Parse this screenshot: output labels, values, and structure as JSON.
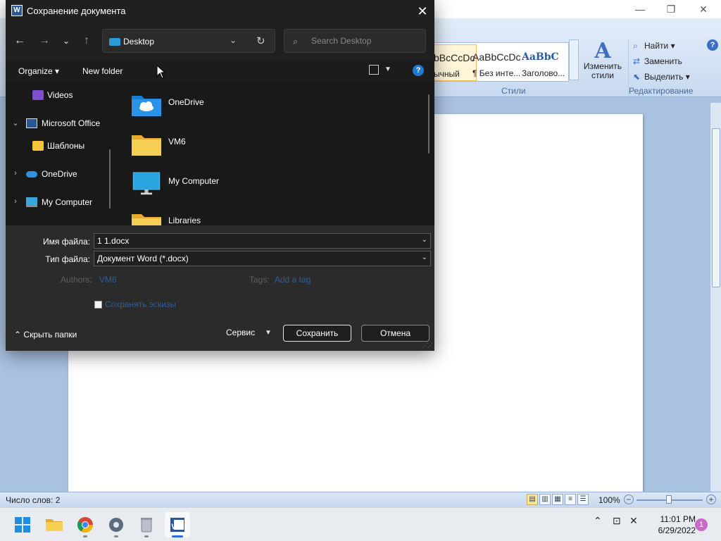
{
  "word": {
    "styles": [
      {
        "sample": "bBcCcDc",
        "name": "ычный",
        "active": true
      },
      {
        "sample": "AaBbCcDc",
        "name": "¶ Без инте...",
        "active": false
      },
      {
        "sample": "AaBbC",
        "name": "Заголово...",
        "active": false
      }
    ],
    "change_styles_label_1": "Изменить",
    "change_styles_label_2": "стили",
    "styles_group_label": "Стили",
    "editing": {
      "find": "Найти",
      "replace": "Заменить",
      "select": "Выделить",
      "group_label": "Редактирование"
    },
    "status": {
      "word_count": "Число слов: 2",
      "zoom": "100%"
    }
  },
  "dialog": {
    "title": "Сохранение документа",
    "address": "Desktop",
    "search_placeholder": "Search Desktop",
    "organize": "Organize",
    "new_folder": "New folder",
    "nav_tree": [
      {
        "label": "Videos",
        "icon": "videos-icon"
      },
      {
        "label": "Microsoft Office",
        "icon": "office-icon"
      },
      {
        "label": "Шаблоны",
        "icon": "folder-icon"
      },
      {
        "label": "OneDrive",
        "icon": "onedrive-icon"
      },
      {
        "label": "My Computer",
        "icon": "monitor-icon"
      }
    ],
    "files": [
      {
        "label": "OneDrive",
        "icon": "onedrive-folder-icon"
      },
      {
        "label": "VM6",
        "icon": "folder-icon"
      },
      {
        "label": "My Computer",
        "icon": "monitor-icon"
      },
      {
        "label": "Libraries",
        "icon": "folder-icon"
      }
    ],
    "filename_label": "Имя файла:",
    "filename_value": "1 1.docx",
    "filetype_label": "Тип файла:",
    "filetype_value": "Документ Word (*.docx)",
    "authors_label": "Authors:",
    "authors_value": "VM6",
    "tags_label": "Tags:",
    "tags_value": "Add a tag",
    "save_thumbnails": "Сохранять эскизы",
    "hide_folders": "Скрыть папки",
    "tools": "Сервис",
    "save": "Сохранить",
    "cancel": "Отмена"
  },
  "taskbar": {
    "time": "11:01 PM",
    "date": "6/29/2022",
    "notifications": "1"
  },
  "colors": {
    "dialog_bg": "#202020",
    "accent": "#1f7ad6",
    "word_frame": "#a9c2e1"
  }
}
